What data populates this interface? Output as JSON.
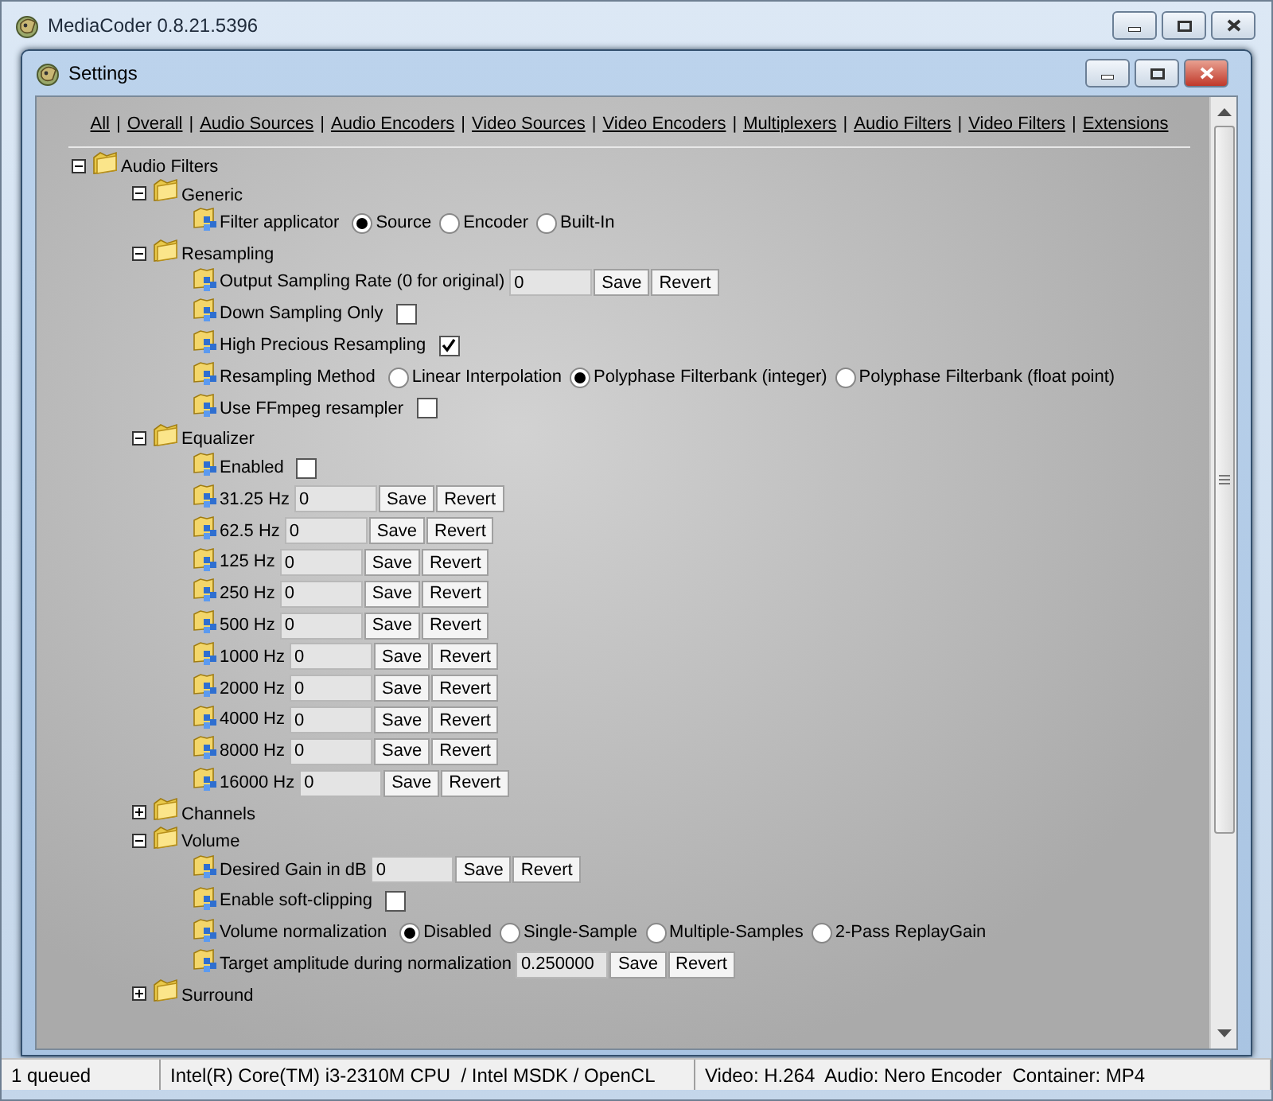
{
  "window": {
    "title": "MediaCoder 0.8.21.5396"
  },
  "dialog": {
    "title": "Settings"
  },
  "nav": [
    {
      "kind": "link",
      "text": "All"
    },
    {
      "kind": "separator",
      "text": "|"
    },
    {
      "kind": "link",
      "text": "Overall"
    },
    {
      "kind": "separator",
      "text": "|"
    },
    {
      "kind": "link",
      "text": "Audio Sources"
    },
    {
      "kind": "separator",
      "text": "|"
    },
    {
      "kind": "link",
      "text": "Audio Encoders"
    },
    {
      "kind": "separator",
      "text": "|"
    },
    {
      "kind": "link",
      "text": "Video Sources"
    },
    {
      "kind": "separator",
      "text": "|"
    },
    {
      "kind": "link",
      "text": "Video Encoders"
    },
    {
      "kind": "separator",
      "text": "|"
    },
    {
      "kind": "link",
      "text": "Multiplexers"
    },
    {
      "kind": "separator",
      "text": "|"
    },
    {
      "kind": "link",
      "text": "Audio Filters"
    },
    {
      "kind": "separator",
      "text": "|"
    },
    {
      "kind": "link",
      "text": "Video Filters"
    },
    {
      "kind": "separator",
      "text": "|"
    },
    {
      "kind": "link",
      "text": "Extensions"
    }
  ],
  "tree": [
    {
      "kind": "group",
      "label": "Audio Filters",
      "expanded": true,
      "children": [
        {
          "kind": "group",
          "label": "Generic",
          "expanded": true,
          "children": [
            {
              "kind": "radio",
              "label": "Filter applicator",
              "options": [
                {
                  "label": "Source",
                  "selected": true
                },
                {
                  "label": "Encoder",
                  "selected": false
                },
                {
                  "label": "Built-In",
                  "selected": false
                }
              ]
            }
          ]
        },
        {
          "kind": "group",
          "label": "Resampling",
          "expanded": true,
          "children": [
            {
              "kind": "text",
              "label": "Output Sampling Rate (0 for original)",
              "value": "0",
              "buttons": [
                "Save",
                "Revert"
              ]
            },
            {
              "kind": "checkbox",
              "label": "Down Sampling Only",
              "checked": false
            },
            {
              "kind": "checkbox",
              "label": "High Precious Resampling",
              "checked": true
            },
            {
              "kind": "radio",
              "label": "Resampling Method",
              "options": [
                {
                  "label": "Linear Interpolation",
                  "selected": false
                },
                {
                  "label": "Polyphase Filterbank (integer)",
                  "selected": true
                },
                {
                  "label": "Polyphase Filterbank (float point)",
                  "selected": false
                }
              ]
            },
            {
              "kind": "checkbox",
              "label": "Use FFmpeg resampler",
              "checked": false
            }
          ]
        },
        {
          "kind": "group",
          "label": "Equalizer",
          "expanded": true,
          "children": [
            {
              "kind": "checkbox",
              "label": "Enabled",
              "checked": false
            },
            {
              "kind": "text",
              "label": "31.25 Hz",
              "value": "0",
              "buttons": [
                "Save",
                "Revert"
              ]
            },
            {
              "kind": "text",
              "label": "62.5 Hz",
              "value": "0",
              "buttons": [
                "Save",
                "Revert"
              ]
            },
            {
              "kind": "text",
              "label": "125 Hz",
              "value": "0",
              "buttons": [
                "Save",
                "Revert"
              ]
            },
            {
              "kind": "text",
              "label": "250 Hz",
              "value": "0",
              "buttons": [
                "Save",
                "Revert"
              ]
            },
            {
              "kind": "text",
              "label": "500 Hz",
              "value": "0",
              "buttons": [
                "Save",
                "Revert"
              ]
            },
            {
              "kind": "text",
              "label": "1000 Hz",
              "value": "0",
              "buttons": [
                "Save",
                "Revert"
              ]
            },
            {
              "kind": "text",
              "label": "2000 Hz",
              "value": "0",
              "buttons": [
                "Save",
                "Revert"
              ]
            },
            {
              "kind": "text",
              "label": "4000 Hz",
              "value": "0",
              "buttons": [
                "Save",
                "Revert"
              ]
            },
            {
              "kind": "text",
              "label": "8000 Hz",
              "value": "0",
              "buttons": [
                "Save",
                "Revert"
              ]
            },
            {
              "kind": "text",
              "label": "16000 Hz",
              "value": "0",
              "buttons": [
                "Save",
                "Revert"
              ]
            }
          ]
        },
        {
          "kind": "group",
          "label": "Channels",
          "expanded": false
        },
        {
          "kind": "group",
          "label": "Volume",
          "expanded": true,
          "children": [
            {
              "kind": "text",
              "label": "Desired Gain in dB",
              "value": "0",
              "buttons": [
                "Save",
                "Revert"
              ]
            },
            {
              "kind": "checkbox",
              "label": "Enable soft-clipping",
              "checked": false
            },
            {
              "kind": "radio",
              "label": "Volume normalization",
              "options": [
                {
                  "label": "Disabled",
                  "selected": true
                },
                {
                  "label": "Single-Sample",
                  "selected": false
                },
                {
                  "label": "Multiple-Samples",
                  "selected": false
                },
                {
                  "label": "2-Pass ReplayGain",
                  "selected": false
                }
              ]
            },
            {
              "kind": "text",
              "label": "Target amplitude during normalization",
              "value": "0.250000",
              "buttons": [
                "Save",
                "Revert"
              ]
            }
          ]
        },
        {
          "kind": "group",
          "label": "Surround",
          "expanded": false
        }
      ]
    }
  ],
  "status_bar": [
    "1 queued",
    "Intel(R) Core(TM) i3-2310M CPU  / Intel MSDK / OpenCL",
    "Video: H.264  Audio: Nero Encoder  Container: MP4"
  ]
}
